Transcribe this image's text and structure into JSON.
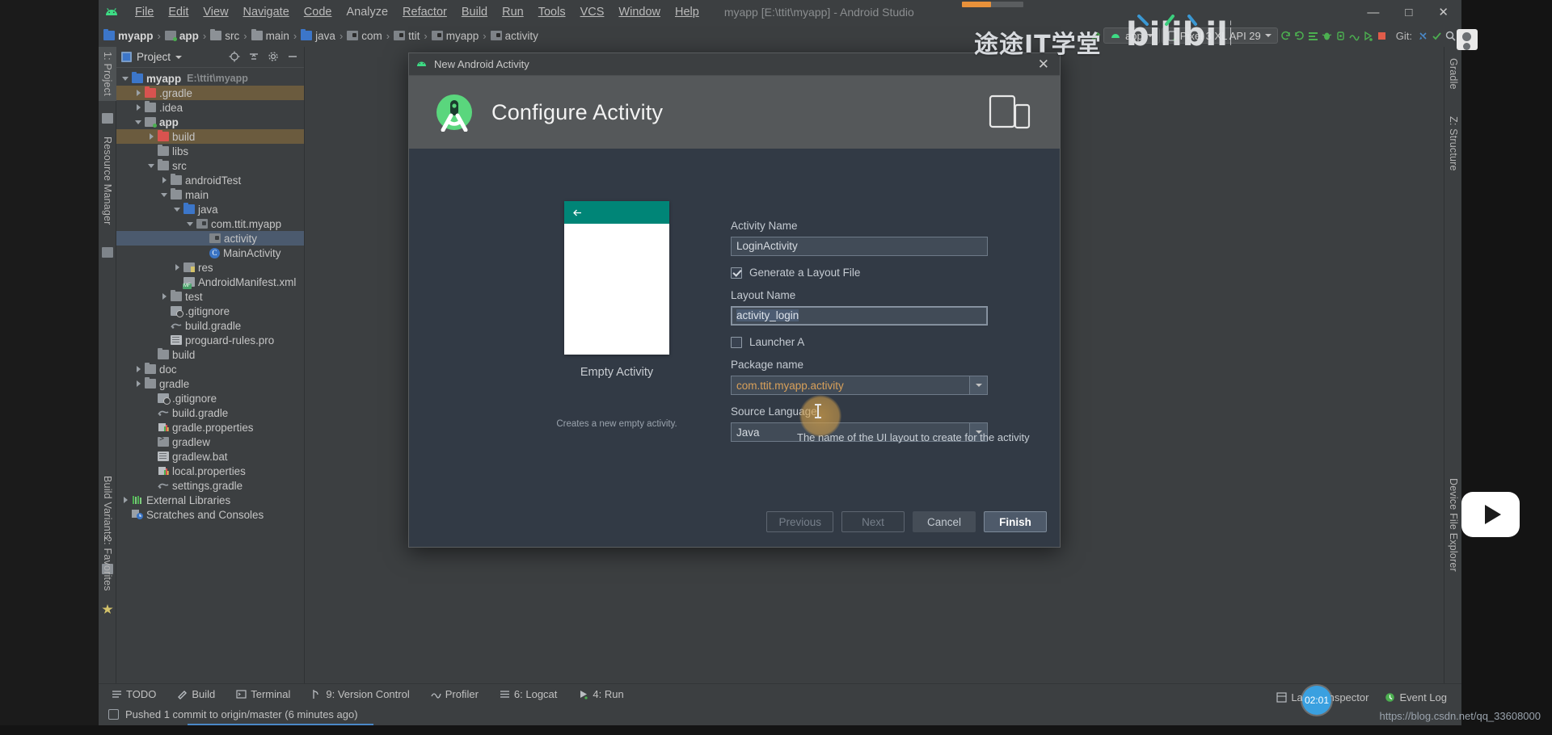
{
  "window": {
    "title": "myapp [E:\\ttit\\myapp] - Android Studio",
    "minimize": "—",
    "maximize": "□",
    "close": "✕"
  },
  "menubar": {
    "logo": "android-logo-icon",
    "items": [
      "File",
      "Edit",
      "View",
      "Navigate",
      "Code",
      "Analyze",
      "Refactor",
      "Build",
      "Run",
      "Tools",
      "VCS",
      "Window",
      "Help"
    ]
  },
  "breadcrumb": {
    "items": [
      {
        "label": "myapp",
        "icon": "folder-module-icon",
        "bold": true
      },
      {
        "label": "app",
        "icon": "module-icon",
        "bold": true
      },
      {
        "label": "src",
        "icon": "folder-icon",
        "bold": false
      },
      {
        "label": "main",
        "icon": "folder-icon",
        "bold": false
      },
      {
        "label": "java",
        "icon": "folder-source-icon",
        "bold": false
      },
      {
        "label": "com",
        "icon": "package-icon",
        "bold": false
      },
      {
        "label": "ttit",
        "icon": "package-icon",
        "bold": false
      },
      {
        "label": "myapp",
        "icon": "package-icon",
        "bold": false
      },
      {
        "label": "activity",
        "icon": "package-icon",
        "bold": false
      }
    ],
    "separator": "›"
  },
  "toolbar": {
    "run_config": "app",
    "device": "Pixel 3 XL API 29",
    "git_label": "Git:",
    "icons": [
      "hammer-icon",
      "sync-gradle-icon",
      "avd-manager-icon",
      "sdk-manager-icon",
      "debug-icon",
      "attach-debugger-icon",
      "profiler-icon",
      "run-icon",
      "stop-icon",
      "update-project-icon",
      "commit-icon",
      "search-icon"
    ]
  },
  "left_strip": {
    "project_tab": "1: Project",
    "resource_manager_tab": "Resource Manager",
    "build_variants_tab": "Build Variants",
    "favorites_tab": "2: Favorites"
  },
  "right_strip": {
    "gradle_tab": "Gradle",
    "structure_tab": "Z: Structure",
    "device_file_explorer_tab": "Device File Explorer"
  },
  "project_panel": {
    "title": "Project",
    "actions": [
      "target-icon",
      "collapse-all-icon",
      "settings-gear-icon",
      "hide-icon"
    ],
    "tree": [
      {
        "label": "myapp",
        "suffix": "E:\\ttit\\myapp",
        "icon": "folder-module-icon",
        "indent": 0,
        "arrow": "down",
        "bold": true,
        "highlight": ""
      },
      {
        "label": ".gradle",
        "suffix": "",
        "icon": "folder-excluded-icon",
        "indent": 1,
        "arrow": "right",
        "bold": false,
        "highlight": "brown"
      },
      {
        "label": ".idea",
        "suffix": "",
        "icon": "folder-icon",
        "indent": 1,
        "arrow": "right",
        "bold": false,
        "highlight": ""
      },
      {
        "label": "app",
        "suffix": "",
        "icon": "module-icon",
        "indent": 1,
        "arrow": "down",
        "bold": true,
        "highlight": ""
      },
      {
        "label": "build",
        "suffix": "",
        "icon": "folder-excluded-icon",
        "indent": 2,
        "arrow": "right",
        "bold": false,
        "highlight": "brown"
      },
      {
        "label": "libs",
        "suffix": "",
        "icon": "folder-icon",
        "indent": 2,
        "arrow": "none",
        "bold": false,
        "highlight": ""
      },
      {
        "label": "src",
        "suffix": "",
        "icon": "folder-icon",
        "indent": 2,
        "arrow": "down",
        "bold": false,
        "highlight": ""
      },
      {
        "label": "androidTest",
        "suffix": "",
        "icon": "folder-icon",
        "indent": 3,
        "arrow": "right",
        "bold": false,
        "highlight": ""
      },
      {
        "label": "main",
        "suffix": "",
        "icon": "folder-icon",
        "indent": 3,
        "arrow": "down",
        "bold": false,
        "highlight": ""
      },
      {
        "label": "java",
        "suffix": "",
        "icon": "folder-source-icon",
        "indent": 4,
        "arrow": "down",
        "bold": false,
        "highlight": ""
      },
      {
        "label": "com.ttit.myapp",
        "suffix": "",
        "icon": "package-icon",
        "indent": 5,
        "arrow": "down",
        "bold": false,
        "highlight": ""
      },
      {
        "label": "activity",
        "suffix": "",
        "icon": "package-icon",
        "indent": 6,
        "arrow": "none",
        "bold": false,
        "highlight": "blue"
      },
      {
        "label": "MainActivity",
        "suffix": "",
        "icon": "java-class-icon",
        "indent": 6,
        "arrow": "none",
        "bold": false,
        "highlight": ""
      },
      {
        "label": "res",
        "suffix": "",
        "icon": "folder-res-icon",
        "indent": 4,
        "arrow": "right",
        "bold": false,
        "highlight": ""
      },
      {
        "label": "AndroidManifest.xml",
        "suffix": "",
        "icon": "manifest-icon",
        "indent": 4,
        "arrow": "none",
        "bold": false,
        "highlight": ""
      },
      {
        "label": "test",
        "suffix": "",
        "icon": "folder-icon",
        "indent": 3,
        "arrow": "right",
        "bold": false,
        "highlight": ""
      },
      {
        "label": ".gitignore",
        "suffix": "",
        "icon": "gitignore-icon",
        "indent": 3,
        "arrow": "none",
        "bold": false,
        "highlight": ""
      },
      {
        "label": "build.gradle",
        "suffix": "",
        "icon": "gradle-icon",
        "indent": 3,
        "arrow": "none",
        "bold": false,
        "highlight": ""
      },
      {
        "label": "proguard-rules.pro",
        "suffix": "",
        "icon": "text-file-icon",
        "indent": 3,
        "arrow": "none",
        "bold": false,
        "highlight": ""
      },
      {
        "label": "build",
        "suffix": "",
        "icon": "folder-icon",
        "indent": 2,
        "arrow": "none",
        "bold": false,
        "highlight": ""
      },
      {
        "label": "doc",
        "suffix": "",
        "icon": "folder-icon",
        "indent": 1,
        "arrow": "right",
        "bold": false,
        "highlight": ""
      },
      {
        "label": "gradle",
        "suffix": "",
        "icon": "folder-icon",
        "indent": 1,
        "arrow": "right",
        "bold": false,
        "highlight": ""
      },
      {
        "label": ".gitignore",
        "suffix": "",
        "icon": "gitignore-icon",
        "indent": 2,
        "arrow": "none",
        "bold": false,
        "highlight": ""
      },
      {
        "label": "build.gradle",
        "suffix": "",
        "icon": "gradle-icon",
        "indent": 2,
        "arrow": "none",
        "bold": false,
        "highlight": ""
      },
      {
        "label": "gradle.properties",
        "suffix": "",
        "icon": "properties-icon",
        "indent": 2,
        "arrow": "none",
        "bold": false,
        "highlight": ""
      },
      {
        "label": "gradlew",
        "suffix": "",
        "icon": "script-icon",
        "indent": 2,
        "arrow": "none",
        "bold": false,
        "highlight": ""
      },
      {
        "label": "gradlew.bat",
        "suffix": "",
        "icon": "text-file-icon",
        "indent": 2,
        "arrow": "none",
        "bold": false,
        "highlight": ""
      },
      {
        "label": "local.properties",
        "suffix": "",
        "icon": "properties-icon",
        "indent": 2,
        "arrow": "none",
        "bold": false,
        "highlight": ""
      },
      {
        "label": "settings.gradle",
        "suffix": "",
        "icon": "gradle-icon",
        "indent": 2,
        "arrow": "none",
        "bold": false,
        "highlight": ""
      },
      {
        "label": "External Libraries",
        "suffix": "",
        "icon": "libraries-icon",
        "indent": 0,
        "arrow": "right",
        "bold": false,
        "highlight": ""
      },
      {
        "label": "Scratches and Consoles",
        "suffix": "",
        "icon": "scratches-icon",
        "indent": 0,
        "arrow": "none",
        "bold": false,
        "highlight": ""
      }
    ]
  },
  "dialog": {
    "titlebar": "New Android Activity",
    "titlebar_icon": "android-icon",
    "close_label": "✕",
    "header_title": "Configure Activity",
    "header_icon": "android-studio-icon",
    "device_icon": "devices-icon",
    "preview": {
      "caption": "Empty Activity",
      "description": "Creates a new empty activity.",
      "back_arrow_icon": "arrow-back-icon"
    },
    "fields": {
      "activity_name_label": "Activity Name",
      "activity_name_value": "LoginActivity",
      "generate_layout_label": "Generate a Layout File",
      "generate_layout_checked": true,
      "layout_name_label": "Layout Name",
      "layout_name_value": "activity_login",
      "launcher_label": "Launcher A",
      "launcher_checked": false,
      "package_name_label": "Package name",
      "package_name_value": "com.ttit.myapp.activity",
      "source_language_label": "Source Language",
      "source_language_value": "Java"
    },
    "tooltip": "The name of the UI layout to create for the activity",
    "buttons": {
      "previous": "Previous",
      "next": "Next",
      "cancel": "Cancel",
      "finish": "Finish"
    }
  },
  "bottom_bar": {
    "items": [
      {
        "label": "TODO",
        "icon": "todo-icon",
        "mnemonic": ""
      },
      {
        "label": "Build",
        "icon": "build-hammer-icon",
        "mnemonic": ""
      },
      {
        "label": "Terminal",
        "icon": "terminal-icon",
        "mnemonic": ""
      },
      {
        "label": "9: Version Control",
        "icon": "vcs-branch-icon",
        "mnemonic": "9"
      },
      {
        "label": "Profiler",
        "icon": "profiler-icon",
        "mnemonic": ""
      },
      {
        "label": "6: Logcat",
        "icon": "logcat-icon",
        "mnemonic": "6"
      },
      {
        "label": "4: Run",
        "icon": "run-green-icon",
        "mnemonic": "4"
      }
    ]
  },
  "status_bar": {
    "message": "Pushed 1 commit to origin/master (6 minutes ago)",
    "icon": "event-log-icon"
  },
  "bottom_right": {
    "layout_inspector": "Layout Inspector",
    "event_log": "Event Log",
    "time_bubble": "02:01"
  },
  "watermark": {
    "text": "途途IT学堂",
    "brand": "bilibili",
    "url": "https://blog.csdn.net/qq_33608000"
  },
  "colors": {
    "ide_bg": "#3c3f41",
    "dialog_body": "#323a45",
    "accent_green": "#4caf50",
    "appbar_teal": "#008577",
    "selection_blue": "#4b5a6e",
    "excluded_brown": "#6b5b3e",
    "package_orange": "#d8a05a"
  }
}
